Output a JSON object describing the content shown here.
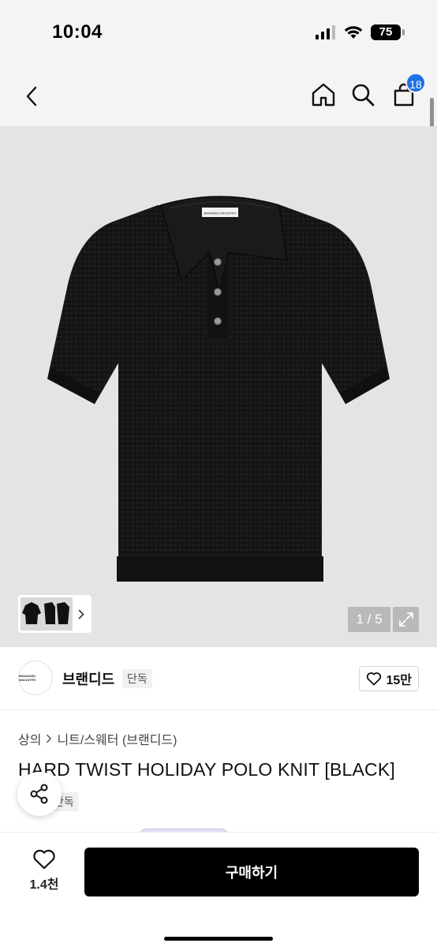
{
  "status_bar": {
    "time": "10:04",
    "battery": "75"
  },
  "nav": {
    "cart_count": "18"
  },
  "gallery": {
    "page_counter": "1 / 5",
    "shirt_label": "BRANDED INDUSTRY"
  },
  "brand": {
    "logo_text": "BRANDED INDUSTRY",
    "name": "브랜디드",
    "tag": "단독",
    "likes": "15만"
  },
  "product": {
    "breadcrumb": [
      "상의",
      "니트/스웨터 (브랜디드)"
    ],
    "title": "HARD TWIST HOLIDAY POLO KNIT [BLACK]",
    "exclusive_tag": "단독"
  },
  "bottom_bar": {
    "wish_count": "1.4천",
    "buy_label": "구매하기"
  },
  "colors": {
    "badge": "#1f6fe6",
    "buy_button": "#000000",
    "image_bg": "#e4e4e4",
    "shirt": "#161616"
  }
}
